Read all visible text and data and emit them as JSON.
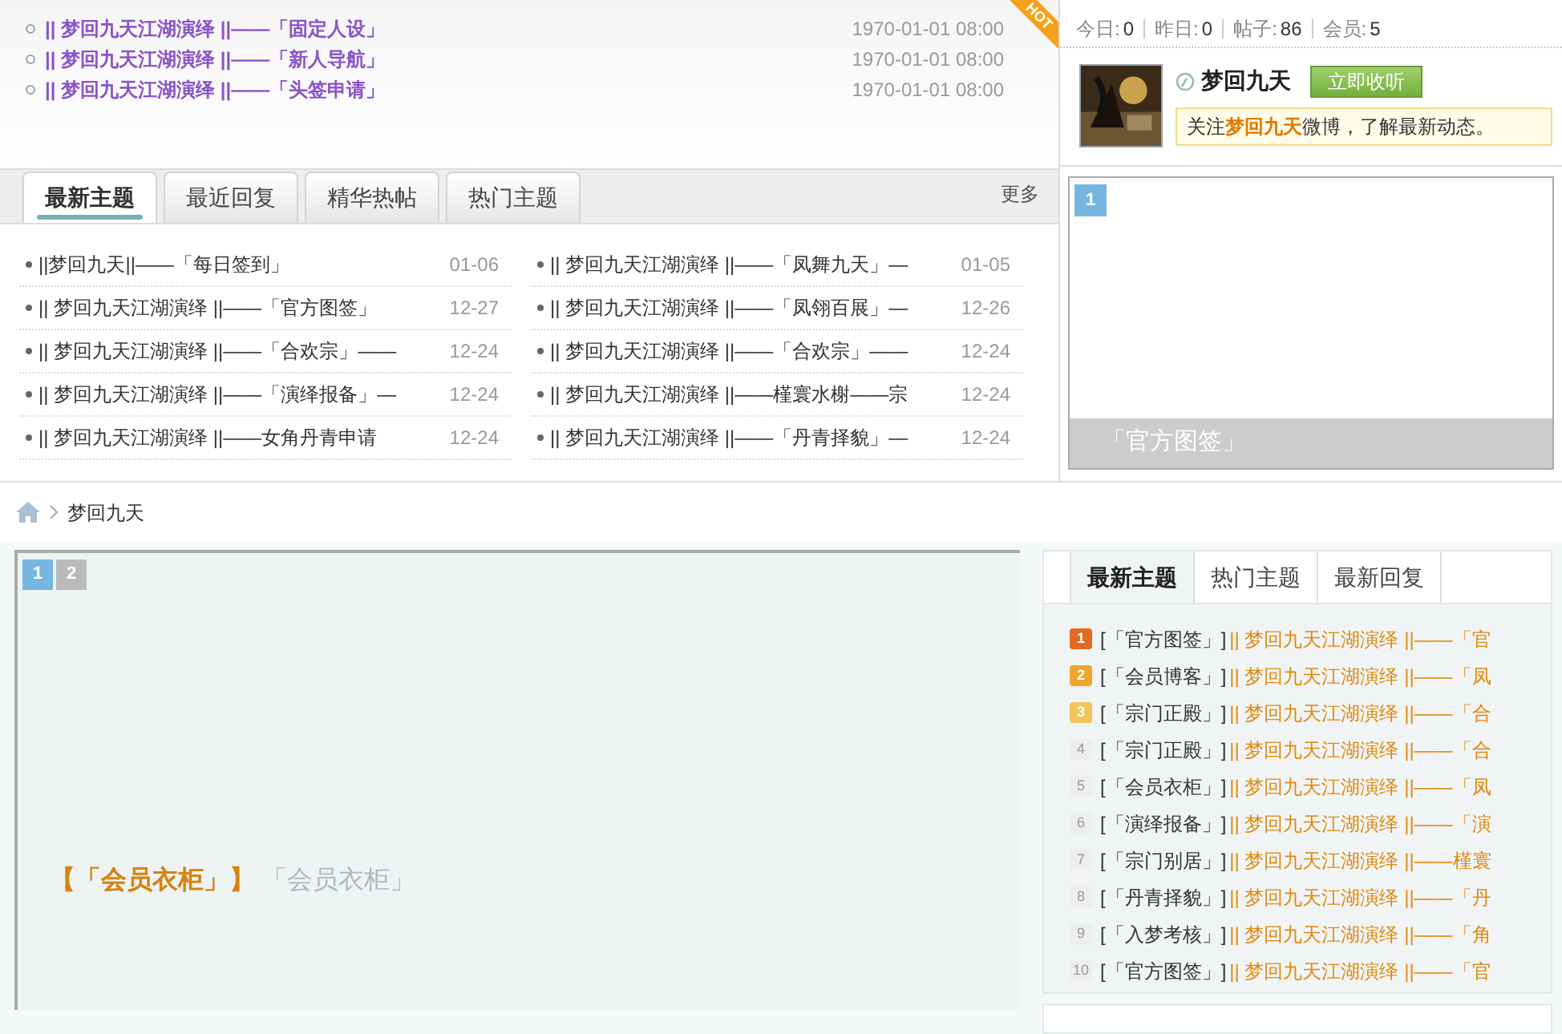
{
  "hot_list": {
    "badge": "HOT",
    "items": [
      {
        "title": "|| 梦回九天江湖演绎 ||——「固定人设」",
        "time": "1970-01-01 08:00"
      },
      {
        "title": "|| 梦回九天江湖演绎 ||——「新人导航」",
        "time": "1970-01-01 08:00"
      },
      {
        "title": "|| 梦回九天江湖演绎 ||——「头签申请」",
        "time": "1970-01-01 08:00"
      }
    ]
  },
  "stats": [
    {
      "label": "今日:",
      "value": "0"
    },
    {
      "label": "昨日:",
      "value": "0"
    },
    {
      "label": "帖子:",
      "value": "86"
    },
    {
      "label": "会员:",
      "value": "5"
    }
  ],
  "weibo": {
    "name": "梦回九天",
    "button": "立即收听",
    "notice": "关注**梦回九天**微博，了解最新动态。"
  },
  "topic_tabs": {
    "tabs": [
      {
        "label": "最新主题",
        "selected": true
      },
      {
        "label": "最近回复",
        "selected": false
      },
      {
        "label": "精华热帖",
        "selected": false
      },
      {
        "label": "热门主题",
        "selected": false
      }
    ],
    "more": "更多"
  },
  "topics": [
    {
      "title": "||梦回九天||——「每日签到」",
      "date": "01-06"
    },
    {
      "title": "|| 梦回九天江湖演绎 ||——「凤舞九天」—",
      "date": "01-05"
    },
    {
      "title": "|| 梦回九天江湖演绎 ||——「官方图签」",
      "date": "12-27"
    },
    {
      "title": "|| 梦回九天江湖演绎 ||——「凤翎百展」—",
      "date": "12-26"
    },
    {
      "title": "|| 梦回九天江湖演绎 ||——「合欢宗」——",
      "date": "12-24"
    },
    {
      "title": "|| 梦回九天江湖演绎 ||——「合欢宗」——",
      "date": "12-24"
    },
    {
      "title": "|| 梦回九天江湖演绎 ||——「演绎报备」—",
      "date": "12-24"
    },
    {
      "title": "|| 梦回九天江湖演绎 ||——槿寰水榭——宗",
      "date": "12-24"
    },
    {
      "title": "|| 梦回九天江湖演绎 ||——女角丹青申请",
      "date": "12-24"
    },
    {
      "title": "|| 梦回九天江湖演绎 ||——「丹青择貌」—",
      "date": "12-24"
    }
  ],
  "side_slider": {
    "pages": [
      {
        "label": "1",
        "selected": true
      }
    ],
    "caption": "「官方图签」"
  },
  "breadcrumb": [
    "梦回九天"
  ],
  "slider": {
    "pages": [
      {
        "label": "1",
        "selected": true
      },
      {
        "label": "2",
        "selected": false
      }
    ],
    "title": "【「会员衣柜」】",
    "subtitle": "「会员衣柜」"
  },
  "ranking": {
    "tabs": [
      {
        "label": "最新主题",
        "selected": true
      },
      {
        "label": "热门主题",
        "selected": false
      },
      {
        "label": "最新回复",
        "selected": false
      }
    ],
    "items": [
      {
        "rank": "1",
        "color": "#e26b1f",
        "category": "[「官方图签」]",
        "title": "|| 梦回九天江湖演绎 ||——「官"
      },
      {
        "rank": "2",
        "color": "#eea62b",
        "category": "[「会员博客」]",
        "title": "|| 梦回九天江湖演绎 ||——「凤"
      },
      {
        "rank": "3",
        "color": "#f2c55a",
        "category": "[「宗门正殿」]",
        "title": "|| 梦回九天江湖演绎 ||——「合"
      },
      {
        "rank": "4",
        "color": "#eeeeee",
        "category": "[「宗门正殿」]",
        "title": "|| 梦回九天江湖演绎 ||——「合"
      },
      {
        "rank": "5",
        "color": "#eeeeee",
        "category": "[「会员衣柜」]",
        "title": "|| 梦回九天江湖演绎 ||——「凤"
      },
      {
        "rank": "6",
        "color": "#eeeeee",
        "category": "[「演绎报备」]",
        "title": "|| 梦回九天江湖演绎 ||——「演"
      },
      {
        "rank": "7",
        "color": "#eeeeee",
        "category": "[「宗门别居」]",
        "title": "|| 梦回九天江湖演绎 ||——槿寰"
      },
      {
        "rank": "8",
        "color": "#eeeeee",
        "category": "[「丹青择貌」]",
        "title": "|| 梦回九天江湖演绎 ||——「丹"
      },
      {
        "rank": "9",
        "color": "#eeeeee",
        "category": "[「入梦考核」]",
        "title": "|| 梦回九天江湖演绎 ||——「角"
      },
      {
        "rank": "10",
        "color": "#eeeeee",
        "category": "[「官方图签」]",
        "title": "|| 梦回九天江湖演绎 ||——「官"
      }
    ]
  }
}
